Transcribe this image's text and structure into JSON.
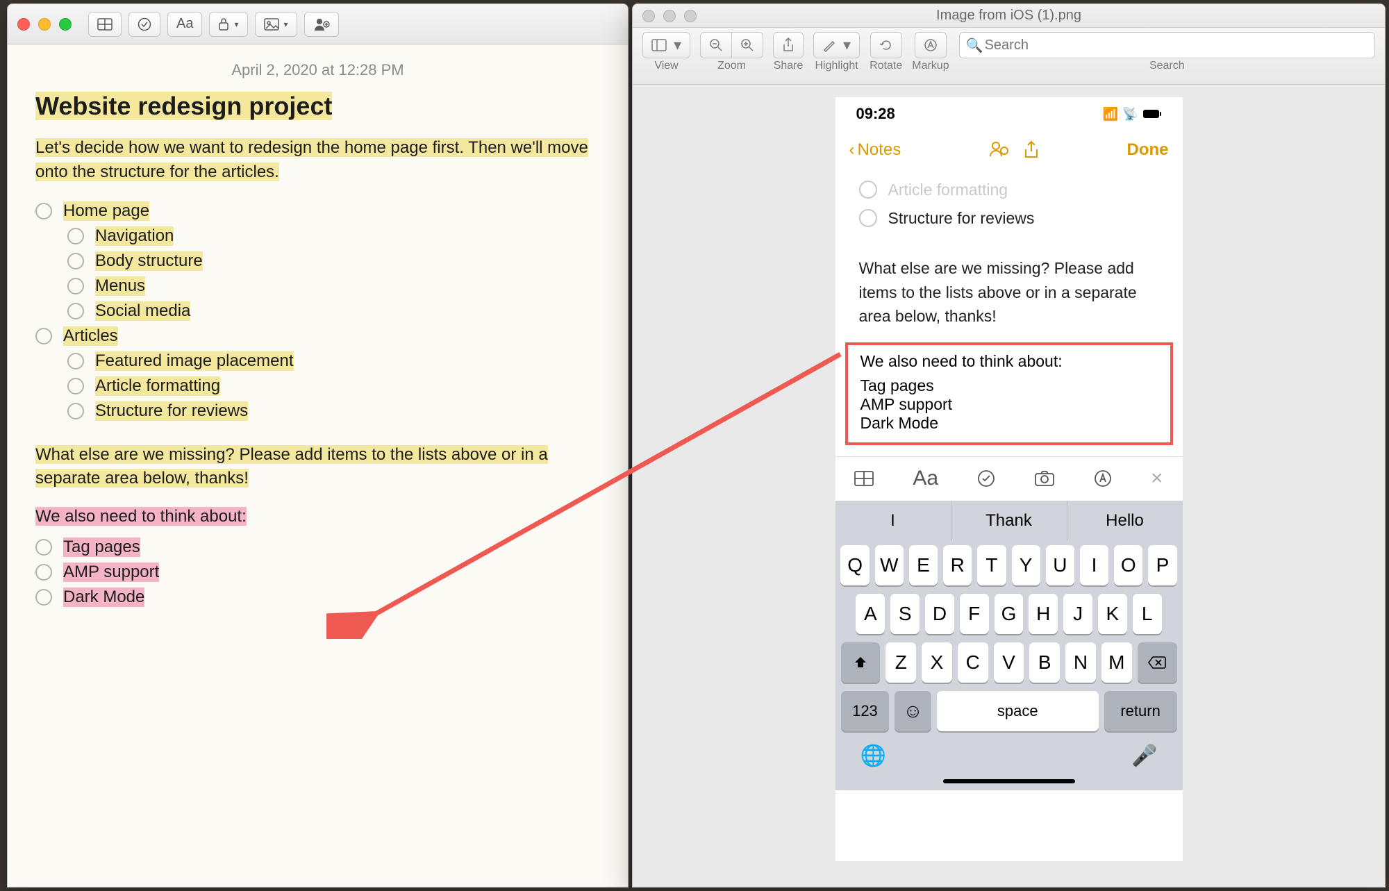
{
  "notes": {
    "date": "April 2, 2020 at 12:28 PM",
    "title": "Website redesign project",
    "intro": "Let's decide how we want to redesign the home page first. Then we'll move onto the structure for the articles.",
    "checklist": [
      {
        "label": "Home page",
        "sub": false
      },
      {
        "label": "Navigation",
        "sub": true
      },
      {
        "label": "Body structure",
        "sub": true
      },
      {
        "label": "Menus",
        "sub": true
      },
      {
        "label": "Social media",
        "sub": true
      },
      {
        "label": "Articles",
        "sub": false
      },
      {
        "label": "Featured image placement",
        "sub": true
      },
      {
        "label": "Article formatting",
        "sub": true
      },
      {
        "label": "Structure for reviews",
        "sub": true
      }
    ],
    "prompt": "What else are we missing? Please add items to the lists above or in a separate area below, thanks!",
    "pink_heading": "We also need to think about:",
    "pink_items": [
      "Tag pages",
      "AMP support",
      "Dark Mode"
    ],
    "toolbar": {
      "checklist_icon": "checklist",
      "format_label": "Aa"
    }
  },
  "preview": {
    "title": "Image from iOS (1).png",
    "toolbar": {
      "view": "View",
      "zoom": "Zoom",
      "share": "Share",
      "highlight": "Highlight",
      "rotate": "Rotate",
      "markup": "Markup",
      "search_label": "Search",
      "search_placeholder": "Search"
    }
  },
  "phone": {
    "time": "09:28",
    "nav_back": "Notes",
    "nav_done": "Done",
    "faded_items": [
      "Article formatting",
      "Structure for reviews"
    ],
    "body_prompt": "What else are we missing? Please add items to the lists above or in a separate area below, thanks!",
    "highlight_heading": "We also need to think about:",
    "highlight_items": [
      "Tag pages",
      "AMP support",
      "Dark Mode"
    ],
    "toolbar_close": "×",
    "suggestions": [
      "I",
      "Thank",
      "Hello"
    ],
    "row1": [
      "Q",
      "W",
      "E",
      "R",
      "T",
      "Y",
      "U",
      "I",
      "O",
      "P"
    ],
    "row2": [
      "A",
      "S",
      "D",
      "F",
      "G",
      "H",
      "J",
      "K",
      "L"
    ],
    "row3": [
      "Z",
      "X",
      "C",
      "V",
      "B",
      "N",
      "M"
    ],
    "num_key": "123",
    "space_key": "space",
    "return_key": "return"
  }
}
